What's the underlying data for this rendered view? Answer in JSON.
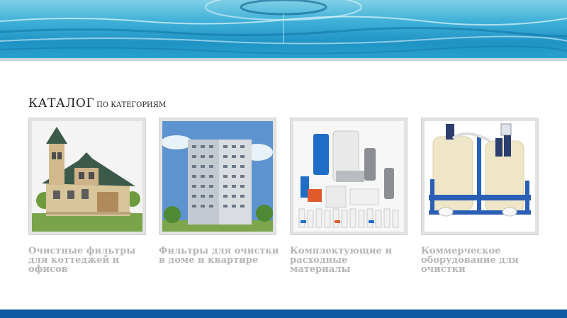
{
  "header": {
    "image_name": "water-ripple-banner"
  },
  "catalog": {
    "heading_main": "КАТАЛОГ",
    "heading_sub": "по категориям",
    "items": [
      {
        "label": "Очистные фильтры для коттеджей и офисов",
        "image": "cottage-house-image"
      },
      {
        "label": "Фильтры для очистки в доме и квартире",
        "image": "apartment-building-image"
      },
      {
        "label": "Комплектующие и расходные материалы",
        "image": "filter-components-image"
      },
      {
        "label": "Коммерческое оборудование для очистки",
        "image": "commercial-tanks-image"
      }
    ]
  },
  "colors": {
    "bottom_bar": "#0d5aa3",
    "label_gray": "#b5b5b5",
    "frame_gray": "#e2e2e2"
  }
}
